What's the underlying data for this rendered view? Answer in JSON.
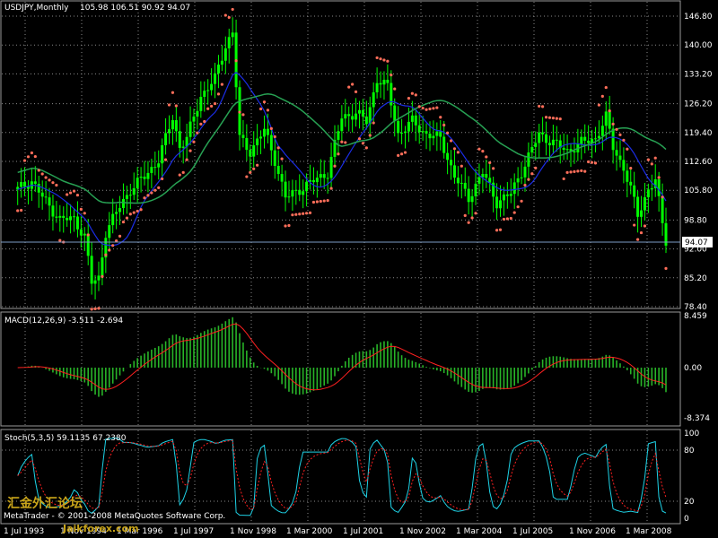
{
  "header": {
    "symbol_info": "USDJPY,Monthly",
    "ohlc": "105.98 106.51 90.92 94.07"
  },
  "colors": {
    "background": "#000000",
    "candle": "#00ff00",
    "ma_fast": "#1b2de6",
    "ma_slow": "#27a153",
    "sar": "#ff6e5a",
    "price_line": "#7d9bc4",
    "macd_hist": "#28b428",
    "macd_signal": "#ff2020",
    "stoch_main": "#1ed2e6",
    "stoch_signal": "#ff2020",
    "watermark": "#c8a419"
  },
  "price_panel": {
    "ticks": [
      "146.80",
      "140.00",
      "133.20",
      "126.20",
      "119.40",
      "112.60",
      "105.80",
      "98.80",
      "92.00",
      "85.20",
      "78.40"
    ],
    "current_price": "94.07"
  },
  "macd_panel": {
    "label": "MACD(12,26,9) -3.511 -2.694",
    "ticks": [
      "8.459",
      "0.00",
      "-8.374"
    ]
  },
  "stoch_panel": {
    "label": "Stoch(5,3,5) 59.1135 67.2380",
    "ticks": [
      "100",
      "80",
      "20",
      "0"
    ]
  },
  "x_axis": {
    "labels": [
      "1 Jul 1993",
      "1 Nov 1994",
      "1 Mar 1996",
      "1 Jul 1997",
      "1 Nov 1998",
      "1 Mar 2000",
      "1 Jul 2001",
      "1 Nov 2002",
      "1 Mar 2004",
      "1 Jul 2005",
      "1 Nov 2006",
      "1 Mar 2008"
    ]
  },
  "footer": {
    "copyright": "MetaTrader - © 2001-2008 MetaQuotes Software Corp.",
    "watermark": "汇金外汇论坛",
    "watermark_url": "Jaikforex.com"
  },
  "chart_data": {
    "type": "candlestick",
    "timeframe": "Monthly",
    "symbol": "USDJPY",
    "price_ylim": [
      78.4,
      146.8
    ],
    "close_series": [
      {
        "date": "1993-07",
        "value": 106
      },
      {
        "date": "1993-11",
        "value": 108
      },
      {
        "date": "1994-03",
        "value": 103
      },
      {
        "date": "1994-07",
        "value": 99
      },
      {
        "date": "1994-11",
        "value": 99
      },
      {
        "date": "1995-02",
        "value": 95
      },
      {
        "date": "1995-04",
        "value": 84
      },
      {
        "date": "1995-06",
        "value": 85
      },
      {
        "date": "1995-08",
        "value": 96
      },
      {
        "date": "1995-12",
        "value": 102
      },
      {
        "date": "1996-03",
        "value": 106
      },
      {
        "date": "1996-07",
        "value": 109
      },
      {
        "date": "1996-11",
        "value": 113
      },
      {
        "date": "1997-03",
        "value": 123
      },
      {
        "date": "1997-05",
        "value": 116
      },
      {
        "date": "1997-07",
        "value": 118
      },
      {
        "date": "1997-11",
        "value": 128
      },
      {
        "date": "1998-03",
        "value": 132
      },
      {
        "date": "1998-06",
        "value": 140
      },
      {
        "date": "1998-08",
        "value": 143
      },
      {
        "date": "1998-10",
        "value": 118
      },
      {
        "date": "1999-01",
        "value": 115
      },
      {
        "date": "1999-05",
        "value": 120
      },
      {
        "date": "1999-08",
        "value": 113
      },
      {
        "date": "1999-11",
        "value": 104
      },
      {
        "date": "2000-03",
        "value": 106
      },
      {
        "date": "2000-07",
        "value": 108
      },
      {
        "date": "2000-11",
        "value": 110
      },
      {
        "date": "2001-03",
        "value": 123
      },
      {
        "date": "2001-07",
        "value": 124
      },
      {
        "date": "2001-10",
        "value": 122
      },
      {
        "date": "2002-01",
        "value": 132
      },
      {
        "date": "2002-04",
        "value": 130
      },
      {
        "date": "2002-07",
        "value": 119
      },
      {
        "date": "2002-11",
        "value": 122
      },
      {
        "date": "2003-03",
        "value": 119
      },
      {
        "date": "2003-07",
        "value": 118
      },
      {
        "date": "2003-11",
        "value": 109
      },
      {
        "date": "2004-03",
        "value": 104
      },
      {
        "date": "2004-07",
        "value": 110
      },
      {
        "date": "2004-11",
        "value": 103
      },
      {
        "date": "2005-03",
        "value": 105
      },
      {
        "date": "2005-07",
        "value": 112
      },
      {
        "date": "2005-11",
        "value": 119
      },
      {
        "date": "2006-03",
        "value": 117
      },
      {
        "date": "2006-07",
        "value": 115
      },
      {
        "date": "2006-11",
        "value": 117
      },
      {
        "date": "2007-03",
        "value": 118
      },
      {
        "date": "2007-06",
        "value": 123
      },
      {
        "date": "2007-08",
        "value": 116
      },
      {
        "date": "2007-11",
        "value": 111
      },
      {
        "date": "2008-01",
        "value": 106
      },
      {
        "date": "2008-03",
        "value": 100
      },
      {
        "date": "2008-06",
        "value": 106
      },
      {
        "date": "2008-08",
        "value": 108
      },
      {
        "date": "2008-10",
        "value": 98
      },
      {
        "date": "2008-11",
        "value": 94
      }
    ],
    "macd": {
      "range": [
        -8.374,
        8.459
      ],
      "last": -3.511,
      "signal": -2.694
    },
    "stochastic": {
      "range": [
        0,
        100
      ],
      "levels": [
        20,
        80
      ],
      "main": 59.1135,
      "signal": 67.238
    }
  }
}
